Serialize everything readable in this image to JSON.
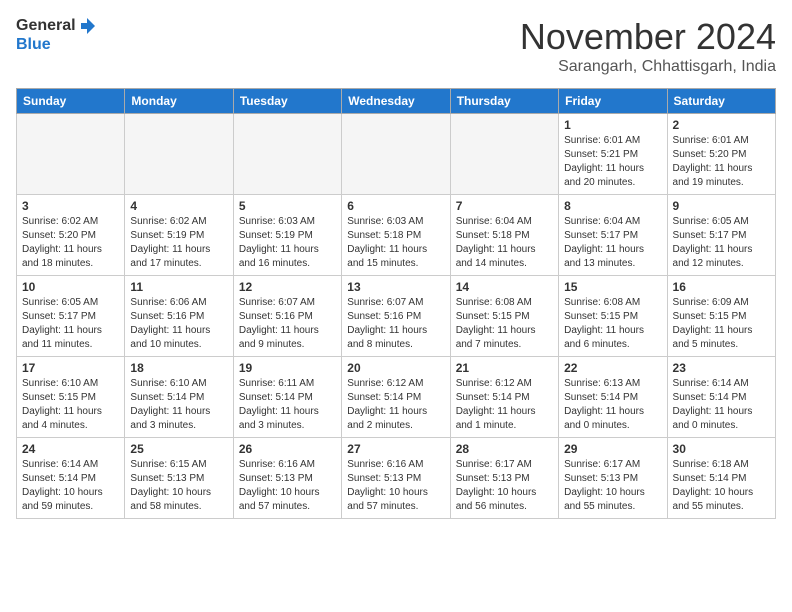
{
  "header": {
    "logo_general": "General",
    "logo_blue": "Blue",
    "month_title": "November 2024",
    "location": "Sarangarh, Chhattisgarh, India"
  },
  "days_of_week": [
    "Sunday",
    "Monday",
    "Tuesday",
    "Wednesday",
    "Thursday",
    "Friday",
    "Saturday"
  ],
  "weeks": [
    [
      {
        "day": "",
        "info": ""
      },
      {
        "day": "",
        "info": ""
      },
      {
        "day": "",
        "info": ""
      },
      {
        "day": "",
        "info": ""
      },
      {
        "day": "",
        "info": ""
      },
      {
        "day": "1",
        "info": "Sunrise: 6:01 AM\nSunset: 5:21 PM\nDaylight: 11 hours\nand 20 minutes."
      },
      {
        "day": "2",
        "info": "Sunrise: 6:01 AM\nSunset: 5:20 PM\nDaylight: 11 hours\nand 19 minutes."
      }
    ],
    [
      {
        "day": "3",
        "info": "Sunrise: 6:02 AM\nSunset: 5:20 PM\nDaylight: 11 hours\nand 18 minutes."
      },
      {
        "day": "4",
        "info": "Sunrise: 6:02 AM\nSunset: 5:19 PM\nDaylight: 11 hours\nand 17 minutes."
      },
      {
        "day": "5",
        "info": "Sunrise: 6:03 AM\nSunset: 5:19 PM\nDaylight: 11 hours\nand 16 minutes."
      },
      {
        "day": "6",
        "info": "Sunrise: 6:03 AM\nSunset: 5:18 PM\nDaylight: 11 hours\nand 15 minutes."
      },
      {
        "day": "7",
        "info": "Sunrise: 6:04 AM\nSunset: 5:18 PM\nDaylight: 11 hours\nand 14 minutes."
      },
      {
        "day": "8",
        "info": "Sunrise: 6:04 AM\nSunset: 5:17 PM\nDaylight: 11 hours\nand 13 minutes."
      },
      {
        "day": "9",
        "info": "Sunrise: 6:05 AM\nSunset: 5:17 PM\nDaylight: 11 hours\nand 12 minutes."
      }
    ],
    [
      {
        "day": "10",
        "info": "Sunrise: 6:05 AM\nSunset: 5:17 PM\nDaylight: 11 hours\nand 11 minutes."
      },
      {
        "day": "11",
        "info": "Sunrise: 6:06 AM\nSunset: 5:16 PM\nDaylight: 11 hours\nand 10 minutes."
      },
      {
        "day": "12",
        "info": "Sunrise: 6:07 AM\nSunset: 5:16 PM\nDaylight: 11 hours\nand 9 minutes."
      },
      {
        "day": "13",
        "info": "Sunrise: 6:07 AM\nSunset: 5:16 PM\nDaylight: 11 hours\nand 8 minutes."
      },
      {
        "day": "14",
        "info": "Sunrise: 6:08 AM\nSunset: 5:15 PM\nDaylight: 11 hours\nand 7 minutes."
      },
      {
        "day": "15",
        "info": "Sunrise: 6:08 AM\nSunset: 5:15 PM\nDaylight: 11 hours\nand 6 minutes."
      },
      {
        "day": "16",
        "info": "Sunrise: 6:09 AM\nSunset: 5:15 PM\nDaylight: 11 hours\nand 5 minutes."
      }
    ],
    [
      {
        "day": "17",
        "info": "Sunrise: 6:10 AM\nSunset: 5:15 PM\nDaylight: 11 hours\nand 4 minutes."
      },
      {
        "day": "18",
        "info": "Sunrise: 6:10 AM\nSunset: 5:14 PM\nDaylight: 11 hours\nand 3 minutes."
      },
      {
        "day": "19",
        "info": "Sunrise: 6:11 AM\nSunset: 5:14 PM\nDaylight: 11 hours\nand 3 minutes."
      },
      {
        "day": "20",
        "info": "Sunrise: 6:12 AM\nSunset: 5:14 PM\nDaylight: 11 hours\nand 2 minutes."
      },
      {
        "day": "21",
        "info": "Sunrise: 6:12 AM\nSunset: 5:14 PM\nDaylight: 11 hours\nand 1 minute."
      },
      {
        "day": "22",
        "info": "Sunrise: 6:13 AM\nSunset: 5:14 PM\nDaylight: 11 hours\nand 0 minutes."
      },
      {
        "day": "23",
        "info": "Sunrise: 6:14 AM\nSunset: 5:14 PM\nDaylight: 11 hours\nand 0 minutes."
      }
    ],
    [
      {
        "day": "24",
        "info": "Sunrise: 6:14 AM\nSunset: 5:14 PM\nDaylight: 10 hours\nand 59 minutes."
      },
      {
        "day": "25",
        "info": "Sunrise: 6:15 AM\nSunset: 5:13 PM\nDaylight: 10 hours\nand 58 minutes."
      },
      {
        "day": "26",
        "info": "Sunrise: 6:16 AM\nSunset: 5:13 PM\nDaylight: 10 hours\nand 57 minutes."
      },
      {
        "day": "27",
        "info": "Sunrise: 6:16 AM\nSunset: 5:13 PM\nDaylight: 10 hours\nand 57 minutes."
      },
      {
        "day": "28",
        "info": "Sunrise: 6:17 AM\nSunset: 5:13 PM\nDaylight: 10 hours\nand 56 minutes."
      },
      {
        "day": "29",
        "info": "Sunrise: 6:17 AM\nSunset: 5:13 PM\nDaylight: 10 hours\nand 55 minutes."
      },
      {
        "day": "30",
        "info": "Sunrise: 6:18 AM\nSunset: 5:14 PM\nDaylight: 10 hours\nand 55 minutes."
      }
    ]
  ]
}
